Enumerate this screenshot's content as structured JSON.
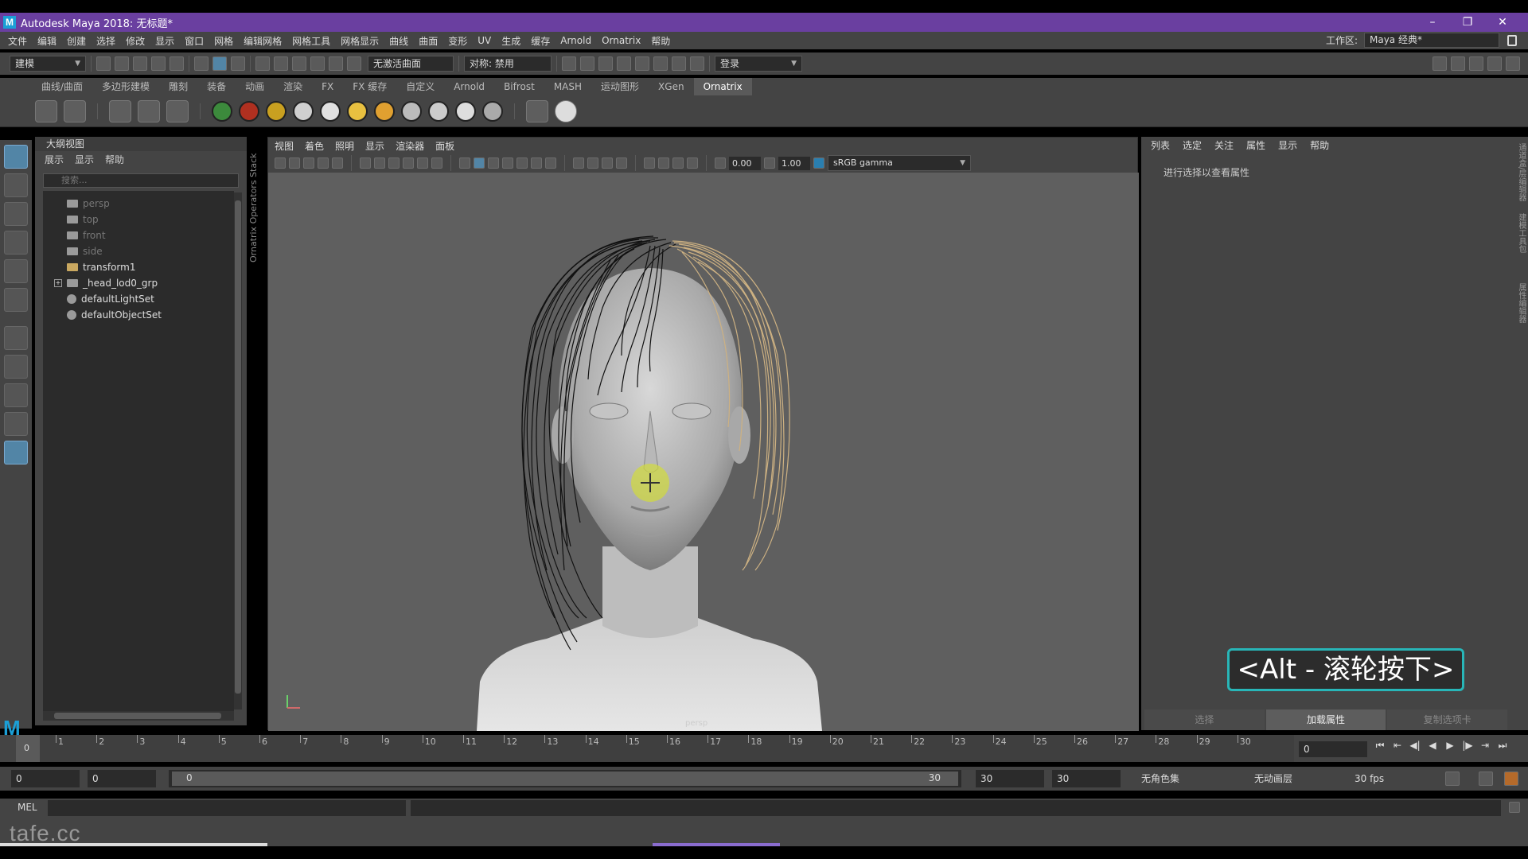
{
  "window": {
    "title": "Autodesk Maya 2018: 无标题*",
    "logo": "M",
    "controls": [
      "–",
      "❐",
      "✕"
    ]
  },
  "menubar": {
    "items": [
      "文件",
      "编辑",
      "创建",
      "选择",
      "修改",
      "显示",
      "窗口",
      "网格",
      "编辑网格",
      "网格工具",
      "网格显示",
      "曲线",
      "曲面",
      "变形",
      "UV",
      "生成",
      "缓存",
      "Arnold",
      "Ornatrix",
      "帮助"
    ],
    "workspace_label": "工作区:",
    "workspace_value": "Maya 经典*"
  },
  "statusline": {
    "mode": "建模",
    "live_surface": "无激活曲面",
    "symmetry": "对称: 禁用",
    "login": "登录"
  },
  "shelf": {
    "tabs": [
      "曲线/曲面",
      "多边形建模",
      "雕刻",
      "装备",
      "动画",
      "渲染",
      "FX",
      "FX 缓存",
      "自定义",
      "Arnold",
      "Bifrost",
      "MASH",
      "运动图形",
      "XGen",
      "Ornatrix"
    ],
    "active_tab": "Ornatrix",
    "ball_colors": [
      "#3c8a3c",
      "#b03020",
      "#c9a020",
      "#d0d0d0",
      "#e0e0e0",
      "#e8c040",
      "#e0a030",
      "#bbbbbb",
      "#cccccc",
      "#dddddd",
      "#aaaaaa"
    ]
  },
  "outliner": {
    "title": "大纲视图",
    "menus": [
      "展示",
      "显示",
      "帮助"
    ],
    "search_placeholder": "搜索...",
    "items": [
      {
        "label": "persp",
        "dim": true
      },
      {
        "label": "top",
        "dim": true
      },
      {
        "label": "front",
        "dim": true
      },
      {
        "label": "side",
        "dim": true
      },
      {
        "label": "transform1",
        "dim": false
      },
      {
        "label": "_head_lod0_grp",
        "dim": false
      },
      {
        "label": "defaultLightSet",
        "dim": false
      },
      {
        "label": "defaultObjectSet",
        "dim": false
      }
    ]
  },
  "ornatrix_stack_label": "Ornatrix Operators Stack",
  "viewport": {
    "menus": [
      "视图",
      "着色",
      "照明",
      "显示",
      "渲染器",
      "面板"
    ],
    "exposure": "0.00",
    "gamma": "1.00",
    "color_space": "sRGB gamma",
    "camera": "persp"
  },
  "attribute_editor": {
    "menus": [
      "列表",
      "选定",
      "关注",
      "属性",
      "显示",
      "帮助"
    ],
    "hint": "进行选择以查看属性",
    "buttons": [
      "选择",
      "加载属性",
      "复制选项卡"
    ],
    "side_tabs": [
      "通道盒/层编辑器",
      "建模工具包",
      "属性编辑器"
    ]
  },
  "key_hint": "<Alt - 滚轮按下>",
  "timeline": {
    "ticks": [
      "1",
      "2",
      "3",
      "4",
      "5",
      "6",
      "7",
      "8",
      "9",
      "10",
      "11",
      "12",
      "13",
      "14",
      "15",
      "16",
      "17",
      "18",
      "19",
      "20",
      "21",
      "22",
      "23",
      "24",
      "25",
      "26",
      "27",
      "28",
      "29",
      "30"
    ],
    "current": "0",
    "current_field": "0",
    "transport": [
      "⏮",
      "⇤",
      "◀|",
      "◀",
      "▶",
      "|▶",
      "⇥",
      "⏭"
    ]
  },
  "range": {
    "start": "0",
    "anim_start": "0",
    "slider_start": "0",
    "slider_end": "30",
    "end": "30",
    "anim_end": "30",
    "character_set": "无角色集",
    "anim_layer": "无动画层",
    "fps": "30 fps"
  },
  "cmdline": {
    "label": "MEL"
  },
  "helpline": {
    "watermark": "tafe.cc"
  }
}
